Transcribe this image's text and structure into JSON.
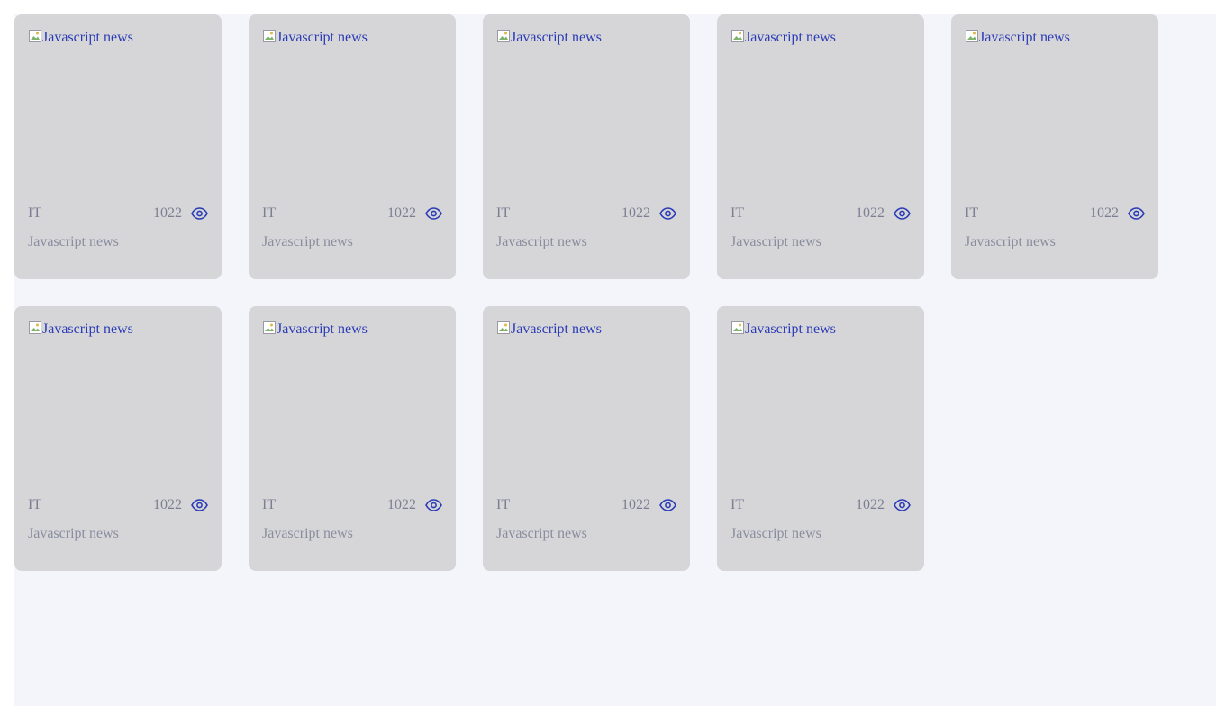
{
  "colors": {
    "background": "#f3f5fa",
    "card": "#d6d6d9",
    "link": "#2a3bb5",
    "meta_text": "#7c7f92",
    "eye_icon": "#2a3bb5"
  },
  "cards": [
    {
      "image_alt": "Javascript news",
      "category": "IT",
      "views": "1022",
      "title": "Javascript news"
    },
    {
      "image_alt": "Javascript news",
      "category": "IT",
      "views": "1022",
      "title": "Javascript news"
    },
    {
      "image_alt": "Javascript news",
      "category": "IT",
      "views": "1022",
      "title": "Javascript news"
    },
    {
      "image_alt": "Javascript news",
      "category": "IT",
      "views": "1022",
      "title": "Javascript news"
    },
    {
      "image_alt": "Javascript news",
      "category": "IT",
      "views": "1022",
      "title": "Javascript news"
    },
    {
      "image_alt": "Javascript news",
      "category": "IT",
      "views": "1022",
      "title": "Javascript news"
    },
    {
      "image_alt": "Javascript news",
      "category": "IT",
      "views": "1022",
      "title": "Javascript news"
    },
    {
      "image_alt": "Javascript news",
      "category": "IT",
      "views": "1022",
      "title": "Javascript news"
    },
    {
      "image_alt": "Javascript news",
      "category": "IT",
      "views": "1022",
      "title": "Javascript news"
    }
  ],
  "icons": {
    "views": "eye-icon",
    "image": "broken-image-icon"
  }
}
